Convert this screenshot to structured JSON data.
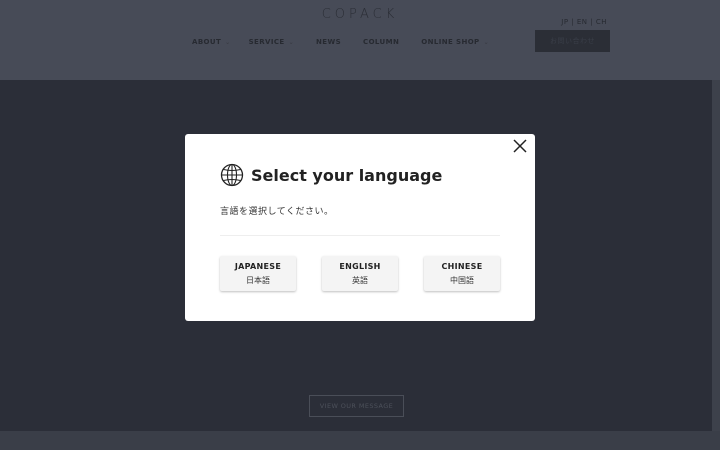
{
  "header": {
    "logo": "COPACK",
    "lang_switch": "JP | EN | CH",
    "nav": [
      {
        "label": "ABOUT",
        "has_dropdown": true
      },
      {
        "label": "SERVICE",
        "has_dropdown": true
      },
      {
        "label": "NEWS",
        "has_dropdown": false
      },
      {
        "label": "COLUMN",
        "has_dropdown": false
      },
      {
        "label": "ONLINE SHOP",
        "has_dropdown": true
      }
    ],
    "contact_label": "お問い合わせ"
  },
  "hero": {
    "message_button": "VIEW OUR MESSAGE"
  },
  "modal": {
    "title": "Select your language",
    "subtitle": "言語を選択してください。",
    "close_icon": "close-icon",
    "globe_icon": "globe-icon",
    "buttons": [
      {
        "label": "JAPANESE",
        "native": "日本語"
      },
      {
        "label": "ENGLISH",
        "native": "英語"
      },
      {
        "label": "CHINESE",
        "native": "中国語"
      }
    ]
  },
  "colors": {
    "overlay_header": "#474b57",
    "overlay_hero": "#2b2e38",
    "modal_bg": "#ffffff",
    "button_bg": "#f4f4f4"
  }
}
